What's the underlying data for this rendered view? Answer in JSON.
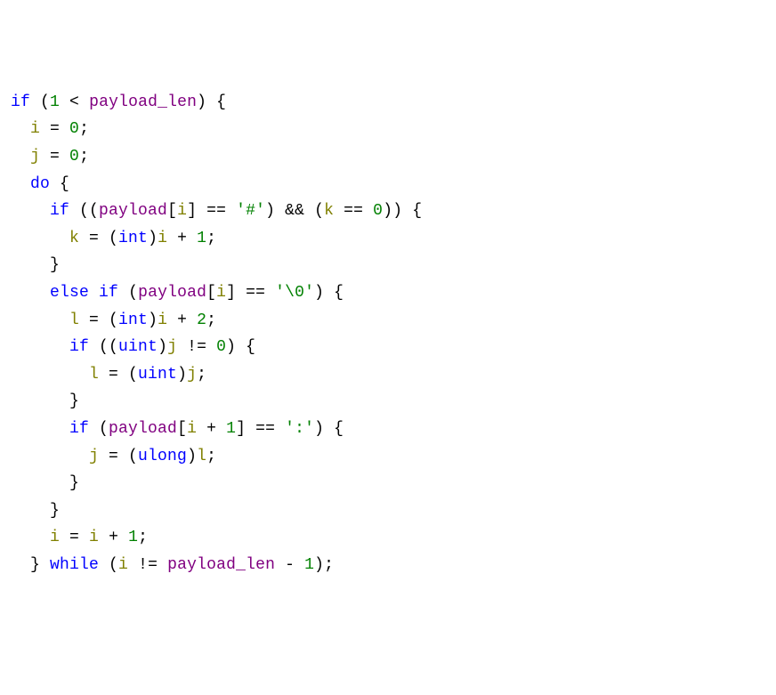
{
  "tokens": [
    [
      [
        "kw",
        "if"
      ],
      [
        "punct",
        " ("
      ],
      [
        "num",
        "1"
      ],
      [
        "punct",
        " < "
      ],
      [
        "ident",
        "payload_len"
      ],
      [
        "punct",
        ") {"
      ]
    ],
    [
      [
        "punct",
        "  "
      ],
      [
        "var",
        "i"
      ],
      [
        "punct",
        " = "
      ],
      [
        "num",
        "0"
      ],
      [
        "punct",
        ";"
      ]
    ],
    [
      [
        "punct",
        "  "
      ],
      [
        "var",
        "j"
      ],
      [
        "punct",
        " = "
      ],
      [
        "num",
        "0"
      ],
      [
        "punct",
        ";"
      ]
    ],
    [
      [
        "punct",
        "  "
      ],
      [
        "kw",
        "do"
      ],
      [
        "punct",
        " {"
      ]
    ],
    [
      [
        "punct",
        "    "
      ],
      [
        "kw",
        "if"
      ],
      [
        "punct",
        " (("
      ],
      [
        "ident",
        "payload"
      ],
      [
        "punct",
        "["
      ],
      [
        "var",
        "i"
      ],
      [
        "punct",
        "] == "
      ],
      [
        "char",
        "'#'"
      ],
      [
        "punct",
        ") && ("
      ],
      [
        "var",
        "k"
      ],
      [
        "punct",
        " == "
      ],
      [
        "num",
        "0"
      ],
      [
        "punct",
        ")) {"
      ]
    ],
    [
      [
        "punct",
        "      "
      ],
      [
        "var",
        "k"
      ],
      [
        "punct",
        " = ("
      ],
      [
        "type",
        "int"
      ],
      [
        "punct",
        ")"
      ],
      [
        "var",
        "i"
      ],
      [
        "punct",
        " + "
      ],
      [
        "num",
        "1"
      ],
      [
        "punct",
        ";"
      ]
    ],
    [
      [
        "punct",
        "    }"
      ]
    ],
    [
      [
        "punct",
        "    "
      ],
      [
        "kw",
        "else"
      ],
      [
        "punct",
        " "
      ],
      [
        "kw",
        "if"
      ],
      [
        "punct",
        " ("
      ],
      [
        "ident",
        "payload"
      ],
      [
        "punct",
        "["
      ],
      [
        "var",
        "i"
      ],
      [
        "punct",
        "] == "
      ],
      [
        "char",
        "'\\0'"
      ],
      [
        "punct",
        ") {"
      ]
    ],
    [
      [
        "punct",
        "      "
      ],
      [
        "var",
        "l"
      ],
      [
        "punct",
        " = ("
      ],
      [
        "type",
        "int"
      ],
      [
        "punct",
        ")"
      ],
      [
        "var",
        "i"
      ],
      [
        "punct",
        " + "
      ],
      [
        "num",
        "2"
      ],
      [
        "punct",
        ";"
      ]
    ],
    [
      [
        "punct",
        "      "
      ],
      [
        "kw",
        "if"
      ],
      [
        "punct",
        " (("
      ],
      [
        "type",
        "uint"
      ],
      [
        "punct",
        ")"
      ],
      [
        "var",
        "j"
      ],
      [
        "punct",
        " != "
      ],
      [
        "num",
        "0"
      ],
      [
        "punct",
        ") {"
      ]
    ],
    [
      [
        "punct",
        "        "
      ],
      [
        "var",
        "l"
      ],
      [
        "punct",
        " = ("
      ],
      [
        "type",
        "uint"
      ],
      [
        "punct",
        ")"
      ],
      [
        "var",
        "j"
      ],
      [
        "punct",
        ";"
      ]
    ],
    [
      [
        "punct",
        "      }"
      ]
    ],
    [
      [
        "punct",
        "      "
      ],
      [
        "kw",
        "if"
      ],
      [
        "punct",
        " ("
      ],
      [
        "ident",
        "payload"
      ],
      [
        "punct",
        "["
      ],
      [
        "var",
        "i"
      ],
      [
        "punct",
        " + "
      ],
      [
        "num",
        "1"
      ],
      [
        "punct",
        "] == "
      ],
      [
        "char",
        "':'"
      ],
      [
        "punct",
        ") {"
      ]
    ],
    [
      [
        "punct",
        "        "
      ],
      [
        "var",
        "j"
      ],
      [
        "punct",
        " = ("
      ],
      [
        "type",
        "ulong"
      ],
      [
        "punct",
        ")"
      ],
      [
        "var",
        "l"
      ],
      [
        "punct",
        ";"
      ]
    ],
    [
      [
        "punct",
        "      }"
      ]
    ],
    [
      [
        "punct",
        "    }"
      ]
    ],
    [
      [
        "punct",
        "    "
      ],
      [
        "var",
        "i"
      ],
      [
        "punct",
        " = "
      ],
      [
        "var",
        "i"
      ],
      [
        "punct",
        " + "
      ],
      [
        "num",
        "1"
      ],
      [
        "punct",
        ";"
      ]
    ],
    [
      [
        "punct",
        "  } "
      ],
      [
        "kw",
        "while"
      ],
      [
        "punct",
        " ("
      ],
      [
        "var",
        "i"
      ],
      [
        "punct",
        " != "
      ],
      [
        "ident",
        "payload_len"
      ],
      [
        "punct",
        " - "
      ],
      [
        "num",
        "1"
      ],
      [
        "punct",
        ");"
      ]
    ]
  ]
}
